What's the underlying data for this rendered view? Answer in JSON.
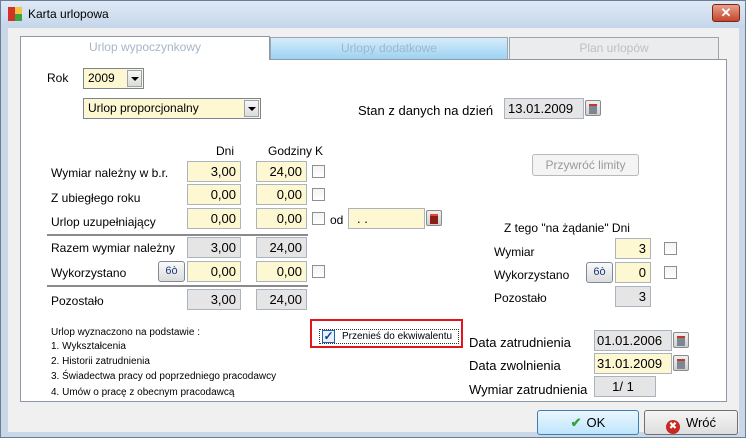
{
  "window": {
    "title": "Karta urlopowa",
    "close_glyph": "✕"
  },
  "tabs": [
    {
      "label": "Urlop wypoczynkowy"
    },
    {
      "label": "Urlopy dodatkowe"
    },
    {
      "label": "Plan urlopów"
    }
  ],
  "year": {
    "label": "Rok",
    "value": "2009"
  },
  "leave_type": {
    "value": "Urlop proporcjonalny"
  },
  "status": {
    "label": "Stan z danych na dzień",
    "date": "13.01.2009"
  },
  "columns": {
    "days": "Dni",
    "hours": "Godziny",
    "k": "K"
  },
  "rows": {
    "entitled": {
      "label": "Wymiar należny w b.r.",
      "days": "3,00",
      "hours": "24,00"
    },
    "previous": {
      "label": "Z ubiegłego roku",
      "days": "0,00",
      "hours": "0,00"
    },
    "supplement": {
      "label": "Urlop uzupełniający",
      "days": "0,00",
      "hours": "0,00",
      "from_label": "od",
      "from_value": " .  ."
    },
    "total": {
      "label": "Razem wymiar należny",
      "days": "3,00",
      "hours": "24,00"
    },
    "used": {
      "label": "Wykorzystano",
      "days": "0,00",
      "hours": "0,00",
      "glasses": "6ò"
    },
    "remaining": {
      "label": "Pozostało",
      "days": "3,00",
      "hours": "24,00"
    }
  },
  "restore_button": "Przywróć limity",
  "on_demand": {
    "header": "Z tego \"na żądanie\"  Dni",
    "quota_label": "Wymiar",
    "quota": "3",
    "used_label": "Wykorzystano",
    "used": "0",
    "remaining_label": "Pozostało",
    "remaining": "3"
  },
  "basis": {
    "title": "Urlop wyznaczono na podstawie :",
    "items": [
      "1. Wykształcenia",
      "2. Historii zatrudnienia",
      "3. Świadectwa pracy od poprzedniego pracodawcy",
      "4. Umów o pracę z obecnym pracodawcą"
    ]
  },
  "transfer": {
    "label": "Przenieś do ekwiwalentu",
    "checked": true,
    "check_glyph": "✓"
  },
  "employment": {
    "start_label": "Data zatrudnienia",
    "start": "01.01.2006",
    "end_label": "Data zwolnienia",
    "end": "31.01.2009",
    "dim_label": "Wymiar zatrudnienia",
    "dim": "1/   1"
  },
  "buttons": {
    "ok": "OK",
    "ok_icon": "✔",
    "back": "Wróć",
    "back_icon": "✖"
  }
}
